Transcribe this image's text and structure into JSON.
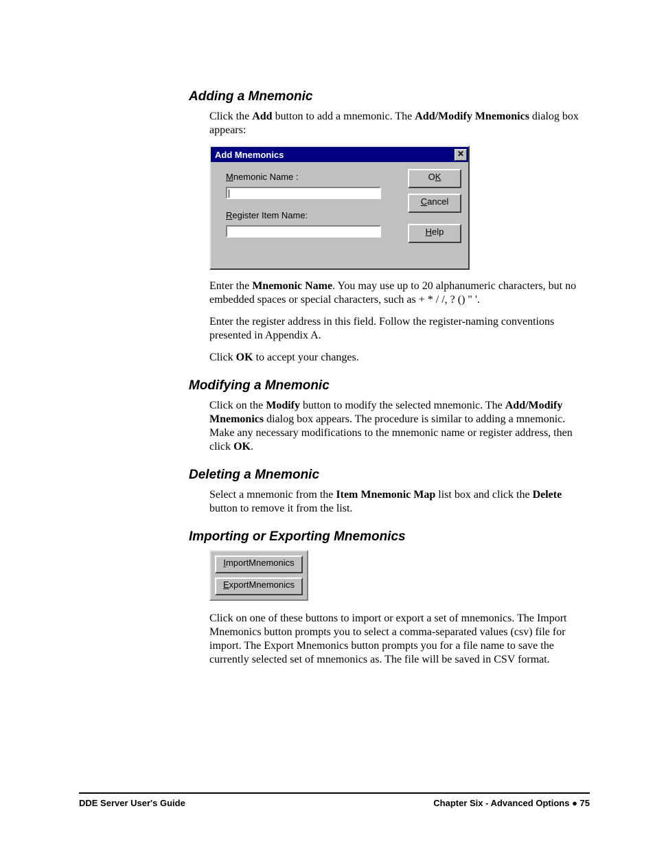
{
  "sections": {
    "adding": {
      "heading": "Adding a Mnemonic",
      "p1_pre": "Click the ",
      "p1_b1": "Add",
      "p1_mid": " button to add a mnemonic. The ",
      "p1_b2": "Add/Modify Mnemonics",
      "p1_post": " dialog box appears:",
      "p2_pre": "Enter the ",
      "p2_b": "Mnemonic Name",
      "p2_post": ". You may use up to 20 alphanumeric characters, but no embedded spaces or special characters, such as + * / /, ? () \" '.",
      "p3": "Enter the register address in this field. Follow the register-naming conventions presented in Appendix A.",
      "p4_pre": "Click ",
      "p4_b": "OK",
      "p4_post": " to accept your changes."
    },
    "modifying": {
      "heading": "Modifying a Mnemonic",
      "p1_pre": "Click on the ",
      "p1_b1": "Modify",
      "p1_mid": " button to modify the selected mnemonic. The ",
      "p1_b2": "Add/Modify Mnemonics",
      "p1_mid2": " dialog box appears. The procedure is similar to adding a mnemonic. Make any necessary modifications to the mnemonic name or register address, then click ",
      "p1_b3": "OK",
      "p1_post": "."
    },
    "deleting": {
      "heading": "Deleting a Mnemonic",
      "p1_pre": "Select a mnemonic from the ",
      "p1_b1": "Item Mnemonic Map",
      "p1_mid": " list box and click the ",
      "p1_b2": "Delete",
      "p1_post": " button to remove it from the list."
    },
    "importing": {
      "heading": "Importing or Exporting Mnemonics",
      "p1": "Click on one of these buttons to import or export a set of mnemonics. The Import Mnemonics button prompts you to select a comma-separated values (csv) file for import. The Export Mnemonics button prompts you for a file name to save the currently selected set of mnemonics as. The file will be saved in CSV format."
    }
  },
  "dialog": {
    "title": "Add Mnemonics",
    "close_glyph": "✕",
    "label1_pre": "M",
    "label1_rest": "nemonic Name :",
    "label2_pre": "R",
    "label2_rest": "egister Item Name:",
    "ok_pre": "O",
    "ok_u": "K",
    "cancel_u": "C",
    "cancel_rest": "ancel",
    "help_u": "H",
    "help_rest": "elp"
  },
  "panel": {
    "import_u": "I",
    "import_rest": "mportMnemonics",
    "export_u": "E",
    "export_rest": "xportMnemonics"
  },
  "footer": {
    "left": "DDE Server User's Guide",
    "right_pre": "Chapter Six - Advanced Options  ",
    "dot": "●",
    "page": "  75"
  }
}
